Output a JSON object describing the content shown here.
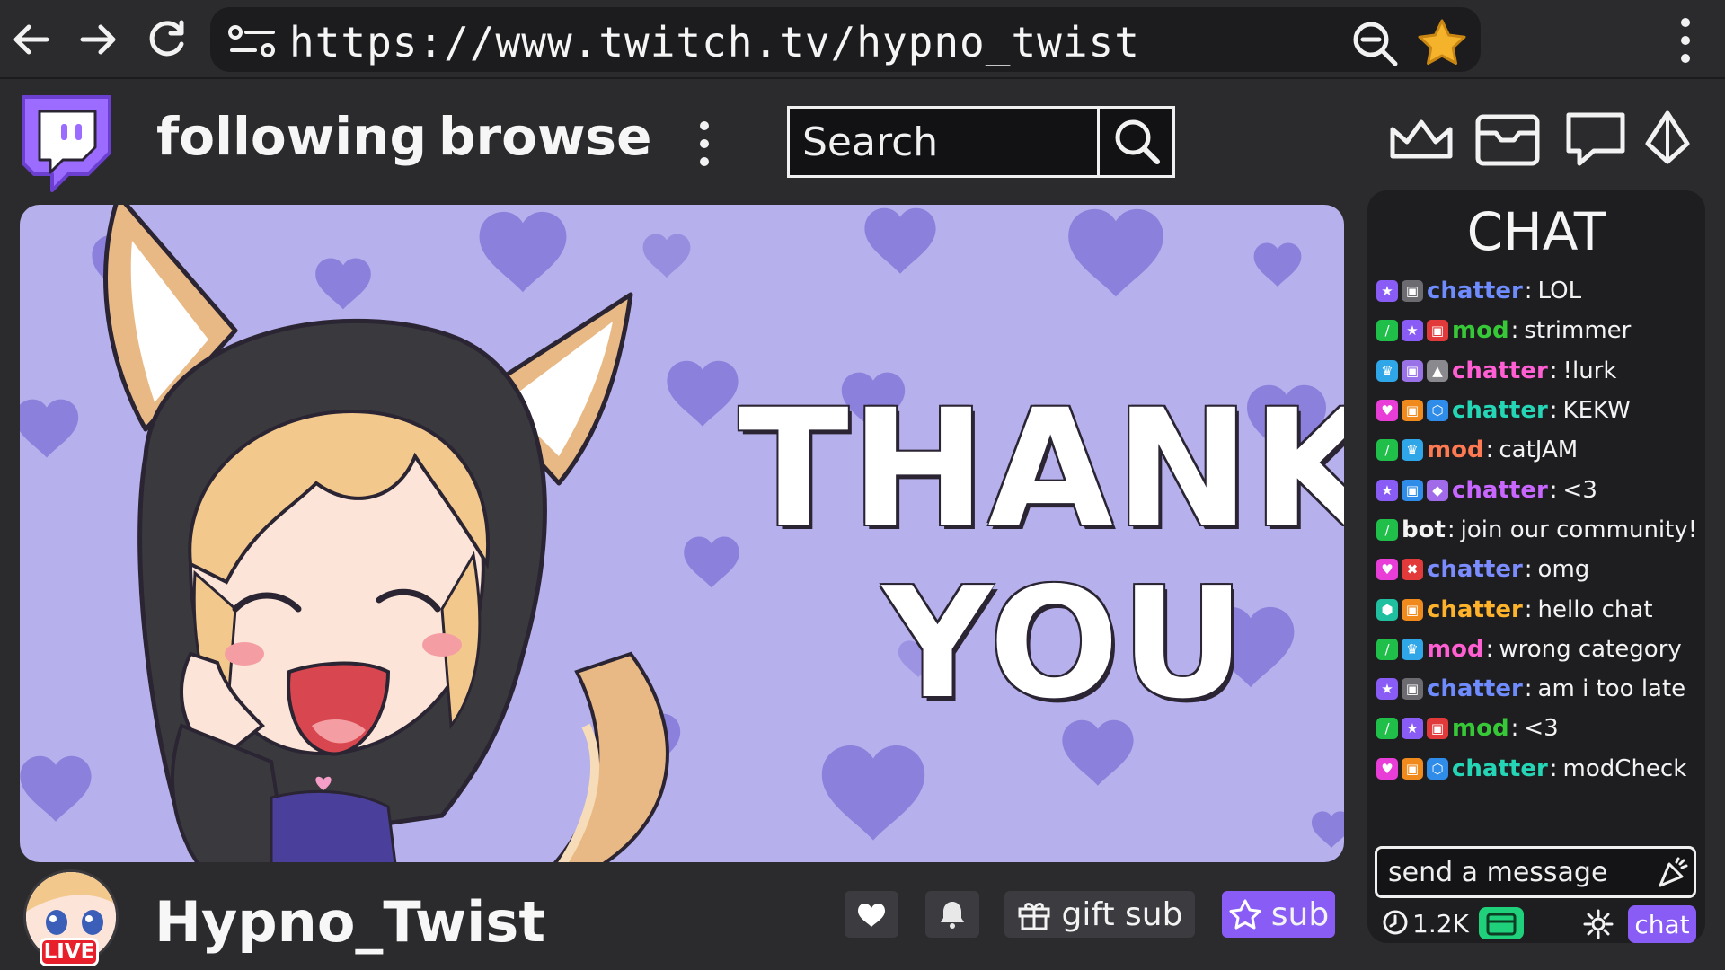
{
  "browser": {
    "url": "https://www.twitch.tv/hypno_twist",
    "back_icon": "back-arrow-icon",
    "forward_icon": "forward-arrow-icon",
    "reload_icon": "reload-icon",
    "site_icon": "site-settings-icon",
    "zoom_icon": "zoom-out-icon",
    "bookmark_icon": "star-icon",
    "menu_icon": "kebab-menu-icon"
  },
  "header": {
    "following_label": "following",
    "browse_label": "browse",
    "search_placeholder": "Search",
    "icons": [
      "crown-icon",
      "inbox-icon",
      "whisper-icon",
      "bits-icon"
    ]
  },
  "stream": {
    "overlay_line1": "THANK",
    "overlay_line2": "YOU",
    "background_color": "#b6b0ec",
    "heart_color": "#8b80dc"
  },
  "channel": {
    "name": "Hypno_Twist",
    "live_label": "LIVE",
    "gift_label": "gift sub",
    "sub_label": "sub"
  },
  "chat": {
    "title": "CHAT",
    "messages": [
      {
        "badges": [
          "purple-star",
          "gray-gift"
        ],
        "user": "chatter",
        "color": "#6f8cff",
        "text": "LOL"
      },
      {
        "badges": [
          "green-sword",
          "purple-star",
          "red-gift"
        ],
        "user": "mod",
        "color": "#37c837",
        "text": "strimmer"
      },
      {
        "badges": [
          "blue-crown",
          "purple-gift",
          "gray-badge"
        ],
        "user": "chatter",
        "color": "#ff5fd2",
        "text": "!lurk"
      },
      {
        "badges": [
          "pink-heart",
          "orange-gift",
          "blue-hex"
        ],
        "user": "chatter",
        "color": "#25d6b6",
        "text": "KEKW"
      },
      {
        "badges": [
          "green-sword",
          "blue-crown"
        ],
        "user": "mod",
        "color": "#ff7a52",
        "text": "catJAM"
      },
      {
        "badges": [
          "purple-star",
          "blue-gift",
          "purple-gem"
        ],
        "user": "chatter",
        "color": "#c867ff",
        "text": "<3"
      },
      {
        "badges": [
          "green-sword"
        ],
        "user": "bot",
        "color": "#f3f3f3",
        "text": "join our community!"
      },
      {
        "badges": [
          "pink-heart",
          "red-x"
        ],
        "user": "chatter",
        "color": "#7b8cff",
        "text": "omg"
      },
      {
        "badges": [
          "teal-hex",
          "orange-gift"
        ],
        "user": "chatter",
        "color": "#ffb32b",
        "text": "hello chat"
      },
      {
        "badges": [
          "green-sword",
          "blue-crown"
        ],
        "user": "mod",
        "color": "#ff5fd2",
        "text": "wrong category"
      },
      {
        "badges": [
          "purple-star",
          "gray-gift"
        ],
        "user": "chatter",
        "color": "#6f8cff",
        "text": "am i too late"
      },
      {
        "badges": [
          "green-sword",
          "purple-star",
          "red-gift"
        ],
        "user": "mod",
        "color": "#37c837",
        "text": "<3"
      },
      {
        "badges": [
          "pink-heart",
          "orange-gift",
          "blue-hex"
        ],
        "user": "chatter",
        "color": "#25d6b6",
        "text": "modCheck"
      }
    ],
    "input_placeholder": "send a message",
    "viewer_count": "1.2K",
    "chat_button": "chat"
  },
  "colors": {
    "accent": "#8a5cf6",
    "background": "#2b2b2e",
    "panel": "#1e1e21",
    "live_red": "#e8202b"
  }
}
